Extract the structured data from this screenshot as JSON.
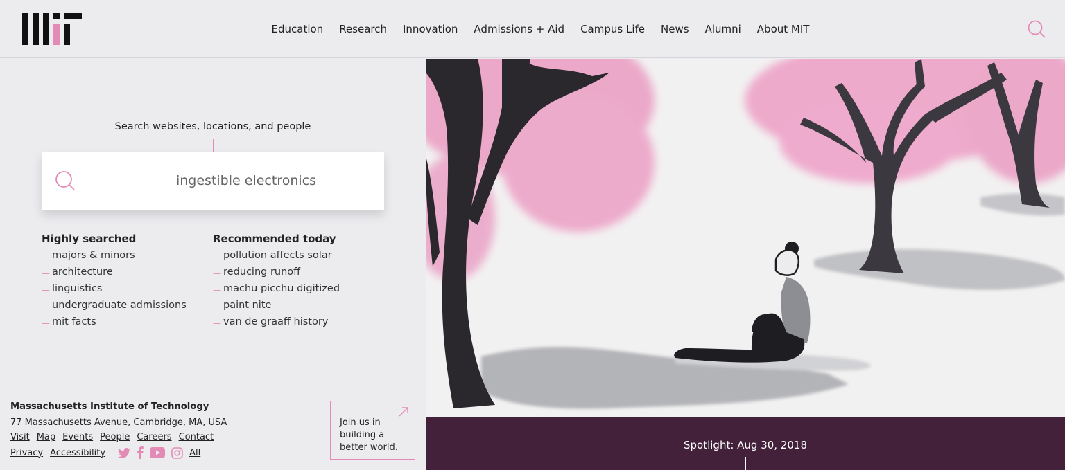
{
  "header": {
    "logo_alt": "MIT",
    "nav": [
      "Education",
      "Research",
      "Innovation",
      "Admissions + Aid",
      "Campus Life",
      "News",
      "Alumni",
      "About MIT"
    ],
    "search_icon": "search-icon"
  },
  "search": {
    "label": "Search websites, locations, and people",
    "value": "ingestible electronics"
  },
  "highly_searched": {
    "title": "Highly searched",
    "items": [
      "majors & minors",
      "architecture",
      "linguistics",
      "undergraduate admissions",
      "mit facts"
    ]
  },
  "recommended": {
    "title": "Recommended today",
    "items": [
      "pollution affects solar",
      "reducing runoff",
      "machu picchu digitized",
      "paint nite",
      "van de graaff history"
    ]
  },
  "footer": {
    "name": "Massachusetts Institute of Technology",
    "address": "77 Massachusetts Avenue, Cambridge, MA, USA",
    "links": [
      "Visit",
      "Map",
      "Events",
      "People",
      "Careers",
      "Contact"
    ],
    "links2": [
      "Privacy",
      "Accessibility"
    ],
    "social_all": "All",
    "social_icons": [
      "twitter-icon",
      "facebook-icon",
      "youtube-icon",
      "instagram-icon"
    ]
  },
  "join": {
    "text_lines": [
      "Join us in",
      "building a",
      "better world."
    ]
  },
  "spotlight": {
    "text": "Spotlight: Aug 30, 2018"
  },
  "colors": {
    "accent": "#e38bb6",
    "spotlight_bg": "#43213a",
    "page_bg": "#ececef"
  }
}
